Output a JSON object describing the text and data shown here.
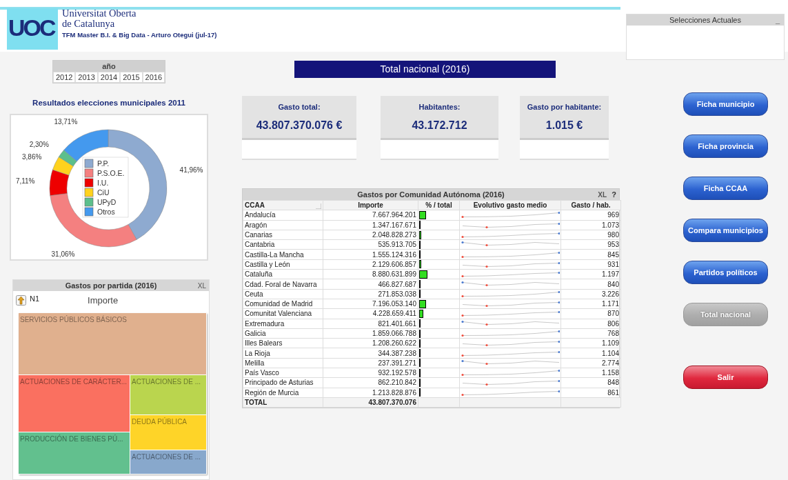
{
  "header": {
    "logo": "UOC",
    "university_line_1": "Universitat Oberta",
    "university_line_2": "de Catalunya",
    "subtitle": "TFM Master B.I. & Big Data - Arturo Otegui (jul-17)"
  },
  "current_selections": {
    "title": "Selecciones Actuales",
    "minimize": "_"
  },
  "year_selector": {
    "title": "año",
    "years": [
      {
        "label": "2012",
        "selected": false
      },
      {
        "label": "2013",
        "selected": false
      },
      {
        "label": "2014",
        "selected": false
      },
      {
        "label": "2015",
        "selected": false
      },
      {
        "label": "2016",
        "selected": false
      }
    ]
  },
  "election_chart": {
    "title": "Resultados elecciones municipales 2011",
    "chart_data": {
      "type": "donut",
      "categories": [
        "P.P.",
        "P.S.O.E.",
        "I.U.",
        "CiU",
        "UPyD",
        "Otros"
      ],
      "legend": true,
      "series": [
        {
          "values": [
            41.96,
            31.06,
            7.11,
            3.86,
            2.3,
            13.71
          ]
        }
      ],
      "colors": [
        "#8eaad0",
        "#f48080",
        "#ee0000",
        "#ffd21e",
        "#5cbf8c",
        "#4499ee"
      ],
      "value_labels": [
        "41,96%",
        "31,06%",
        "7,11%",
        "3,86%",
        "2,30%",
        "13,71%"
      ]
    }
  },
  "treemap": {
    "title": "Gastos por partida (2016)",
    "export": "XL",
    "level": "N1",
    "measure": "Importe",
    "tiles": [
      {
        "label": "SERVICIOS PÚBLICOS BÁSICOS",
        "color": "#e0b08e"
      },
      {
        "label": "ACTUACIONES DE CARÁCTER...",
        "color": "#fa7060"
      },
      {
        "label": "ACTUACIONES DE ...",
        "color": "#bad54e"
      },
      {
        "label": "DEUDA PÚBLICA",
        "color": "#fed428"
      },
      {
        "label": "PRODUCCIÓN DE BIENES PÚ...",
        "color": "#62c08e"
      },
      {
        "label": "ACTUACIONES DE ...",
        "color": "#88a8cc"
      }
    ]
  },
  "banner": "Total nacional (2016)",
  "kpis": [
    {
      "label": "Gasto total:",
      "value": "43.807.370.076 €"
    },
    {
      "label": "Habitantes:",
      "value": "43.172.712"
    },
    {
      "label": "Gasto por habitante:",
      "value": "1.015 €"
    }
  ],
  "table": {
    "title": "Gastos por Comunidad Autónoma (2016)",
    "export": "XL",
    "help": "?",
    "columns": [
      "CCAA",
      "Importe",
      "% / total",
      "Evolutivo gasto medio",
      "Gasto / hab."
    ],
    "rows": [
      {
        "ccaa": "Andalucía",
        "importe": "7.667.964.201",
        "level": 0.175,
        "gasto_hab": "969"
      },
      {
        "ccaa": "Aragón",
        "importe": "1.347.167.671",
        "level": 0.031,
        "gasto_hab": "1.073"
      },
      {
        "ccaa": "Canarias",
        "importe": "2.048.828.273",
        "level": 0.047,
        "gasto_hab": "980"
      },
      {
        "ccaa": "Cantabria",
        "importe": "535.913.705",
        "level": 0.012,
        "gasto_hab": "953"
      },
      {
        "ccaa": "Castilla-La Mancha",
        "importe": "1.555.124.316",
        "level": 0.035,
        "gasto_hab": "845"
      },
      {
        "ccaa": "Castilla y León",
        "importe": "2.129.606.857",
        "level": 0.049,
        "gasto_hab": "931"
      },
      {
        "ccaa": "Cataluña",
        "importe": "8.880.631.899",
        "level": 0.203,
        "gasto_hab": "1.197"
      },
      {
        "ccaa": "Cdad. Foral de Navarra",
        "importe": "466.827.687",
        "level": 0.011,
        "gasto_hab": "840"
      },
      {
        "ccaa": "Ceuta",
        "importe": "271.853.038",
        "level": 0.006,
        "gasto_hab": "3.226"
      },
      {
        "ccaa": "Comunidad de Madrid",
        "importe": "7.196.053.140",
        "level": 0.164,
        "gasto_hab": "1.171"
      },
      {
        "ccaa": "Comunitat Valenciana",
        "importe": "4.228.659.411",
        "level": 0.097,
        "gasto_hab": "870"
      },
      {
        "ccaa": "Extremadura",
        "importe": "821.401.661",
        "level": 0.019,
        "gasto_hab": "806"
      },
      {
        "ccaa": "Galicia",
        "importe": "1.859.066.788",
        "level": 0.042,
        "gasto_hab": "768"
      },
      {
        "ccaa": "Illes Balears",
        "importe": "1.208.260.622",
        "level": 0.028,
        "gasto_hab": "1.109"
      },
      {
        "ccaa": "La Rioja",
        "importe": "344.387.238",
        "level": 0.008,
        "gasto_hab": "1.104"
      },
      {
        "ccaa": "Melilla",
        "importe": "237.391.271",
        "level": 0.005,
        "gasto_hab": "2.774"
      },
      {
        "ccaa": "País Vasco",
        "importe": "932.192.578",
        "level": 0.021,
        "gasto_hab": "1.158"
      },
      {
        "ccaa": "Principado de Asturias",
        "importe": "862.210.842",
        "level": 0.02,
        "gasto_hab": "848"
      },
      {
        "ccaa": "Región de Murcia",
        "importe": "1.213.828.876",
        "level": 0.028,
        "gasto_hab": "861"
      }
    ],
    "total": {
      "label": "TOTAL",
      "importe": "43.807.370.076"
    }
  },
  "buttons": [
    {
      "label": "Ficha municipio",
      "kind": "nav",
      "disabled": false
    },
    {
      "label": "Ficha provincia",
      "kind": "nav",
      "disabled": false
    },
    {
      "label": "Ficha CCAA",
      "kind": "nav",
      "disabled": false
    },
    {
      "label": "Compara municipios",
      "kind": "nav",
      "disabled": false
    },
    {
      "label": "Partidos políticos",
      "kind": "nav",
      "disabled": false
    },
    {
      "label": "Total nacional",
      "kind": "nav",
      "disabled": true
    },
    {
      "label": "Salir",
      "kind": "exit",
      "disabled": false
    }
  ]
}
